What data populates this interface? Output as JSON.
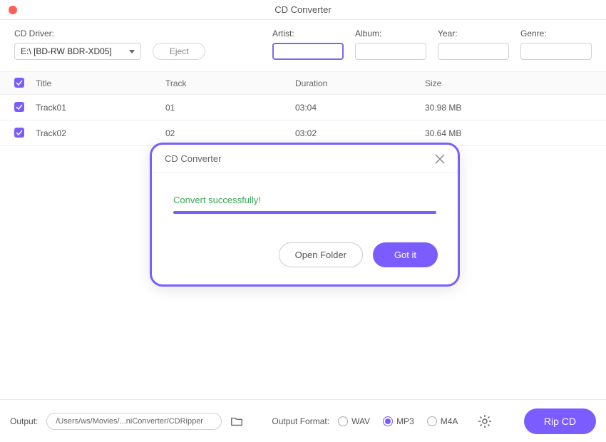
{
  "window": {
    "title": "CD Converter"
  },
  "metadata": {
    "cd_driver_label": "CD Driver:",
    "cd_driver_value": "E:\\ [BD-RW   BDR-XD05]",
    "eject_label": "Eject",
    "artist_label": "Artist:",
    "artist_value": "",
    "album_label": "Album:",
    "album_value": "",
    "year_label": "Year:",
    "year_value": "",
    "genre_label": "Genre:",
    "genre_value": ""
  },
  "table": {
    "headers": {
      "title": "Title",
      "track": "Track",
      "duration": "Duration",
      "size": "Size"
    },
    "rows": [
      {
        "title": "Track01",
        "track": "01",
        "duration": "03:04",
        "size": "30.98 MB"
      },
      {
        "title": "Track02",
        "track": "02",
        "duration": "03:02",
        "size": "30.64 MB"
      }
    ]
  },
  "modal": {
    "title": "CD Converter",
    "message": "Convert successfully!",
    "open_folder_label": "Open Folder",
    "got_it_label": "Got it"
  },
  "footer": {
    "output_label": "Output:",
    "output_path": "/Users/ws/Movies/...niConverter/CDRipper",
    "format_label": "Output Format:",
    "formats": {
      "wav": "WAV",
      "mp3": "MP3",
      "m4a": "M4A"
    },
    "selected_format": "mp3",
    "rip_label": "Rip CD"
  }
}
